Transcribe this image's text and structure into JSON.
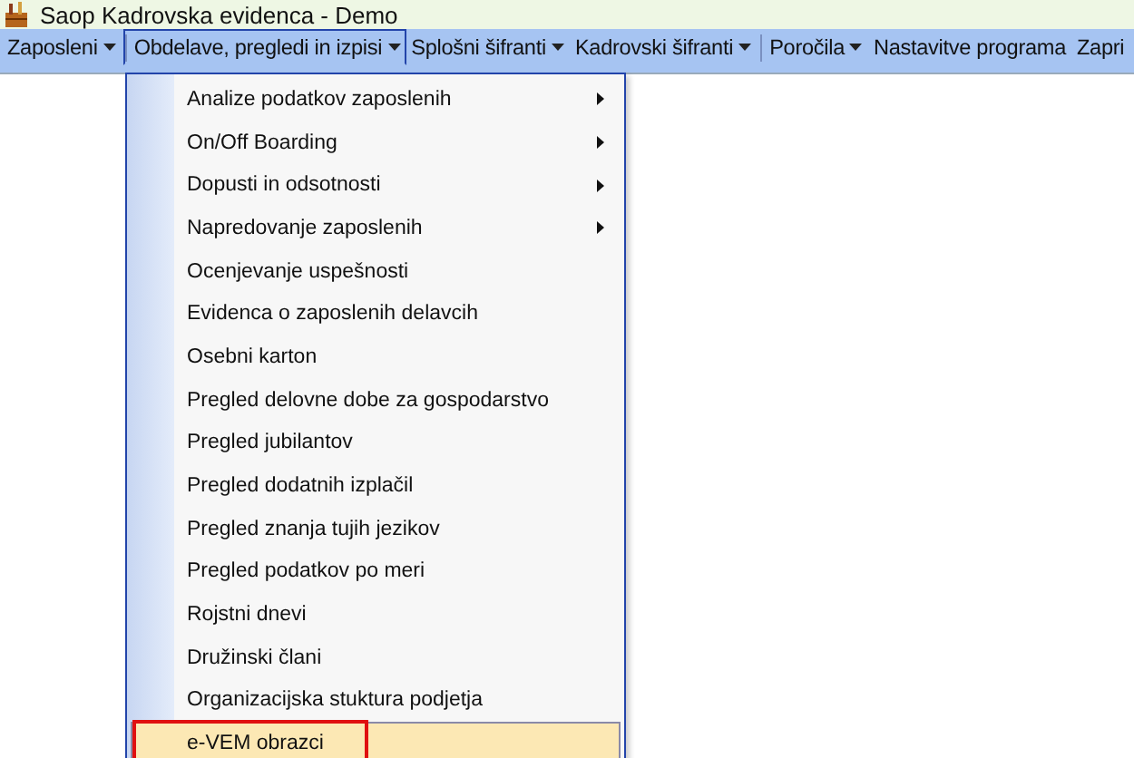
{
  "window": {
    "title": "Saop Kadrovska evidenca  - Demo"
  },
  "menubar": [
    {
      "label": "Zaposleni",
      "dropdown": true,
      "selected": false,
      "separator_before": false
    },
    {
      "label": "Obdelave, pregledi in izpisi",
      "dropdown": true,
      "selected": true,
      "separator_before": true
    },
    {
      "label": "Splošni šifranti",
      "dropdown": true,
      "selected": false,
      "separator_before": false
    },
    {
      "label": "Kadrovski šifranti",
      "dropdown": true,
      "selected": false,
      "separator_before": false
    },
    {
      "label": "Poročila",
      "dropdown": true,
      "selected": false,
      "separator_before": true
    },
    {
      "label": "Nastavitve programa",
      "dropdown": false,
      "selected": false,
      "separator_before": false
    },
    {
      "label": "Zapri",
      "dropdown": false,
      "selected": false,
      "separator_before": false
    }
  ],
  "menu": [
    {
      "label": "Analize podatkov zaposlenih",
      "submenu": true,
      "selected": false,
      "annotated": false
    },
    {
      "label": "On/Off Boarding",
      "submenu": true,
      "selected": false,
      "annotated": false
    },
    {
      "label": "Dopusti in odsotnosti",
      "submenu": true,
      "selected": false,
      "annotated": false
    },
    {
      "label": "Napredovanje zaposlenih",
      "submenu": true,
      "selected": false,
      "annotated": false
    },
    {
      "label": "Ocenjevanje uspešnosti",
      "submenu": false,
      "selected": false,
      "annotated": false
    },
    {
      "label": "Evidenca o zaposlenih delavcih",
      "submenu": false,
      "selected": false,
      "annotated": false
    },
    {
      "label": "Osebni karton",
      "submenu": false,
      "selected": false,
      "annotated": false
    },
    {
      "label": "Pregled delovne dobe za gospodarstvo",
      "submenu": false,
      "selected": false,
      "annotated": false
    },
    {
      "label": "Pregled jubilantov",
      "submenu": false,
      "selected": false,
      "annotated": false
    },
    {
      "label": "Pregled dodatnih izplačil",
      "submenu": false,
      "selected": false,
      "annotated": false
    },
    {
      "label": "Pregled znanja tujih jezikov",
      "submenu": false,
      "selected": false,
      "annotated": false
    },
    {
      "label": "Pregled podatkov po meri",
      "submenu": false,
      "selected": false,
      "annotated": false
    },
    {
      "label": "Rojstni dnevi",
      "submenu": false,
      "selected": false,
      "annotated": false
    },
    {
      "label": "Družinski člani",
      "submenu": false,
      "selected": false,
      "annotated": false
    },
    {
      "label": "Organizacijska stuktura podjetja",
      "submenu": false,
      "selected": false,
      "annotated": false
    },
    {
      "label": "e-VEM obrazci",
      "submenu": false,
      "selected": true,
      "annotated": true
    }
  ]
}
